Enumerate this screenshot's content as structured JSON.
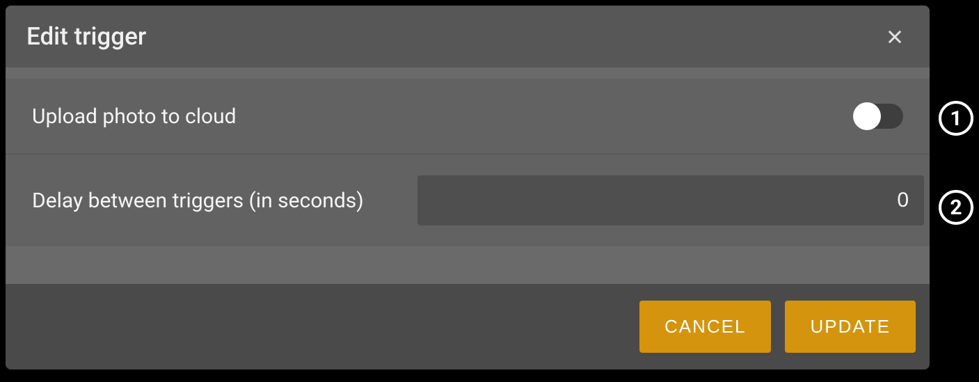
{
  "dialog": {
    "title": "Edit trigger",
    "rows": {
      "upload": {
        "label": "Upload photo to cloud",
        "toggle_on": false
      },
      "delay": {
        "label": "Delay between triggers (in seconds)",
        "value": "0"
      }
    },
    "footer": {
      "cancel": "CANCEL",
      "update": "UPDATE"
    }
  },
  "callouts": {
    "one": "1",
    "two": "2"
  }
}
